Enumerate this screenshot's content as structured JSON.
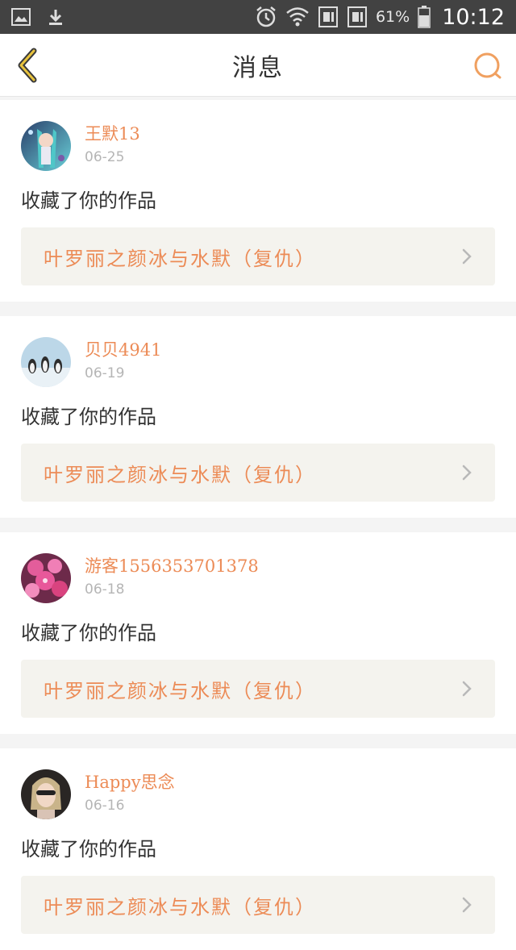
{
  "status_bar": {
    "battery_percent": "61%",
    "time": "10:12",
    "icons": [
      "image-icon",
      "download-icon",
      "alarm-icon",
      "wifi-icon",
      "sim1-icon",
      "sim2-icon",
      "battery-icon"
    ]
  },
  "header": {
    "title": "消息",
    "back_icon": "chevron-left-icon",
    "search_icon": "search-icon"
  },
  "accent_color": "#ec8b56",
  "messages": [
    {
      "user": "王默13",
      "date": "06-25",
      "action": "收藏了你的作品",
      "work": "叶罗丽之颜冰与水默（复仇）"
    },
    {
      "user": "贝贝4941",
      "date": "06-19",
      "action": "收藏了你的作品",
      "work": "叶罗丽之颜冰与水默（复仇）"
    },
    {
      "user": "游客1556353701378",
      "date": "06-18",
      "action": "收藏了你的作品",
      "work": "叶罗丽之颜冰与水默（复仇）"
    },
    {
      "user": "Happy思念",
      "date": "06-16",
      "action": "收藏了你的作品",
      "work": "叶罗丽之颜冰与水默（复仇）"
    }
  ]
}
